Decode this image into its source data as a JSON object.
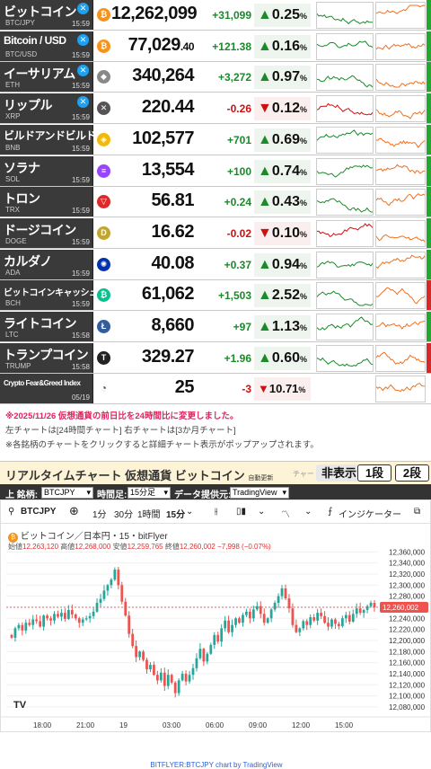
{
  "colors": {
    "up": "#1a8a2a",
    "down": "#cc1111",
    "candle_up": "#26a69a",
    "candle_down": "#ef5350",
    "header_bg": "#3a3a3a"
  },
  "rows": [
    {
      "name": "ビットコイン",
      "symbol": "BTC/JPY",
      "time": "15:59",
      "x": true,
      "icon": "bitcoin-icon",
      "glyph": "₿",
      "icolor": "#f7931a",
      "price": "12,262,099",
      "change": "+31,099",
      "arrow": "▲",
      "pct": "0.25",
      "unit": "%",
      "dir": "up",
      "bar": "#22a830"
    },
    {
      "name": "Bitcoin / USD",
      "symbol": "BTC/USD",
      "time": "15:59",
      "x": true,
      "icon": "bitcoin-icon",
      "glyph": "₿",
      "icolor": "#f7931a",
      "price": "77,029",
      "price_dec": ".40",
      "change": "+121.38",
      "arrow": "▲",
      "pct": "0.16",
      "unit": "%",
      "dir": "up",
      "bar": "#22a830"
    },
    {
      "name": "イーサリアム",
      "symbol": "ETH",
      "time": "15:59",
      "x": true,
      "icon": "ethereum-icon",
      "glyph": "◆",
      "icolor": "#888888",
      "price": "340,264",
      "change": "+3,272",
      "arrow": "▲",
      "pct": "0.97",
      "unit": "%",
      "dir": "up",
      "bar": "#22a830"
    },
    {
      "name": "リップル",
      "symbol": "XRP",
      "time": "15:59",
      "x": true,
      "icon": "xrp-icon",
      "glyph": "✕",
      "icolor": "#555555",
      "price": "220.44",
      "change": "-0.26",
      "arrow": "▼",
      "pct": "0.12",
      "unit": "%",
      "dir": "dn",
      "bar": "#22a830"
    },
    {
      "name": "ビルドアンドビルド",
      "symbol": "BNB",
      "time": "15:59",
      "x": false,
      "icon": "bnb-icon",
      "glyph": "◈",
      "icolor": "#f0b90b",
      "price": "102,577",
      "change": "+701",
      "arrow": "▲",
      "pct": "0.69",
      "unit": "%",
      "dir": "up",
      "bar": "#22a830"
    },
    {
      "name": "ソラナ",
      "symbol": "SOL",
      "time": "15:59",
      "x": false,
      "icon": "solana-icon",
      "glyph": "≡",
      "icolor": "#9945ff",
      "price": "13,554",
      "change": "+100",
      "arrow": "▲",
      "pct": "0.74",
      "unit": "%",
      "dir": "up",
      "bar": "#22a830"
    },
    {
      "name": "トロン",
      "symbol": "TRX",
      "time": "15:59",
      "x": false,
      "icon": "tron-icon",
      "glyph": "▽",
      "icolor": "#e02828",
      "price": "56.81",
      "change": "+0.24",
      "arrow": "▲",
      "pct": "0.43",
      "unit": "%",
      "dir": "up",
      "bar": "#22a830"
    },
    {
      "name": "ドージコイン",
      "symbol": "DOGE",
      "time": "15:59",
      "x": false,
      "icon": "dogecoin-icon",
      "glyph": "D",
      "icolor": "#c2a633",
      "price": "16.62",
      "change": "-0.02",
      "arrow": "▼",
      "pct": "0.10",
      "unit": "%",
      "dir": "dn",
      "bar": "#22a830"
    },
    {
      "name": "カルダノ",
      "symbol": "ADA",
      "time": "15:59",
      "x": false,
      "icon": "cardano-icon",
      "glyph": "✺",
      "icolor": "#0033ad",
      "price": "40.08",
      "change": "+0.37",
      "arrow": "▲",
      "pct": "0.94",
      "unit": "%",
      "dir": "up",
      "bar": "#22a830"
    },
    {
      "name": "ビットコインキャッシュ",
      "symbol": "BCH",
      "time": "15:59",
      "x": false,
      "icon": "bitcoin-cash-icon",
      "glyph": "₿",
      "icolor": "#0ac18e",
      "price": "61,062",
      "change": "+1,503",
      "arrow": "▲",
      "pct": "2.52",
      "unit": "%",
      "dir": "up",
      "bar": "#d62828"
    },
    {
      "name": "ライトコイン",
      "symbol": "LTC",
      "time": "15:58",
      "x": false,
      "icon": "litecoin-icon",
      "glyph": "Ł",
      "icolor": "#345d9d",
      "price": "8,660",
      "change": "+97",
      "arrow": "▲",
      "pct": "1.13",
      "unit": "%",
      "dir": "up",
      "bar": "#22a830"
    },
    {
      "name": "トランプコイン",
      "symbol": "TRUMP",
      "time": "15:58",
      "x": false,
      "icon": "trump-coin-icon",
      "glyph": "T",
      "icolor": "#222222",
      "price": "329.27",
      "change": "+1.96",
      "arrow": "▲",
      "pct": "0.60",
      "unit": "%",
      "dir": "up",
      "bar": "#d62828"
    },
    {
      "name": "Crypto Fear&Greed Index",
      "symbol": "",
      "time": "05/19",
      "x": false,
      "icon": "fear-greed-gauge-icon",
      "glyph": "◔",
      "icolor": "#555555",
      "price": "25",
      "change": "-3",
      "arrow": "▼",
      "pct": "10.71",
      "unit": "%",
      "dir": "dn",
      "bar": ""
    }
  ],
  "notes": {
    "line1": "※2025/11/26 仮想通貨の前日比を24時間比に変更しました。",
    "line2": "左チャートは[24時間チャート] 右チャートは[3か月チャート]",
    "line3": "※各銘柄のチャートをクリックすると詳細チャート表示がポップアップされます。"
  },
  "panel": {
    "title": "リアルタイムチャート 仮想通貨 ビットコイン",
    "auto": "自動更新",
    "chart_label": "チャート",
    "hide": "非表示",
    "btn1": "1段",
    "btn2": "2段",
    "symbol_label": "上 銘柄:",
    "symbol_value": "BTCJPY",
    "interval_label": "時間足:",
    "interval_value": "15分足",
    "provider_label": "データ提供元:",
    "provider_value": "TradingView"
  },
  "tv": {
    "symbol": "BTCJPY",
    "plus": "⊕",
    "intervals": [
      "1分",
      "30分",
      "1時間",
      "15分"
    ],
    "indicators": "インジケーター",
    "info_line": "ビットコイン／日本円・15・bitFlyer",
    "ohlc": {
      "o_label": "始値",
      "o": "12,263,120",
      "h_label": "高値",
      "h": "12,268,000",
      "l_label": "安値",
      "l": "12,259,765",
      "c_label": "終値",
      "c": "12,260,002",
      "chg": "−7,998 (−0.07%)"
    },
    "credit": "BITFLYER:BTCJPY chart by TradingView",
    "logo": "TV"
  },
  "chart_data": {
    "type": "candlestick",
    "symbol": "BTCJPY",
    "interval": "15分",
    "yticks": [
      12360000,
      12340000,
      12320000,
      12300000,
      12280000,
      12260000,
      12240000,
      12220000,
      12200000,
      12180000,
      12160000,
      12140000,
      12120000,
      12100000,
      12080000
    ],
    "ylim": [
      12075000,
      12367000
    ],
    "xticks": [
      "18:00",
      "21:00",
      "19",
      "03:00",
      "06:00",
      "09:00",
      "12:00",
      "15:00"
    ],
    "last_price_label": "12,260,002",
    "close": [
      12205000,
      12222000,
      12228000,
      12218000,
      12232000,
      12228000,
      12238000,
      12235000,
      12225000,
      12245000,
      12240000,
      12236000,
      12248000,
      12243000,
      12250000,
      12239000,
      12255000,
      12247000,
      12240000,
      12232000,
      12238000,
      12240000,
      12244000,
      12252000,
      12268000,
      12275000,
      12290000,
      12300000,
      12310000,
      12328000,
      12300000,
      12270000,
      12245000,
      12212000,
      12190000,
      12170000,
      12180000,
      12165000,
      12148000,
      12156000,
      12138000,
      12128000,
      12142000,
      12118000,
      12138000,
      12124000,
      12105000,
      12128000,
      12140000,
      12126000,
      12138000,
      12150000,
      12168000,
      12185000,
      12162000,
      12176000,
      12192000,
      12210000,
      12198000,
      12222000,
      12236000,
      12215000,
      12228000,
      12240000,
      12232000,
      12246000,
      12252000,
      12240000,
      12256000,
      12262000,
      12248000,
      12232000,
      12240000,
      12256000,
      12268000,
      12280000,
      12294000,
      12276000,
      12258000,
      12228000,
      12215000,
      12222000,
      12235000,
      12228000,
      12242000,
      12236000,
      12250000,
      12244000,
      12232000,
      12225000,
      12238000,
      12230000,
      12226000,
      12240000,
      12246000,
      12234000,
      12248000,
      12258000,
      12250000,
      12255000,
      12262000,
      12268000,
      12260000
    ]
  }
}
